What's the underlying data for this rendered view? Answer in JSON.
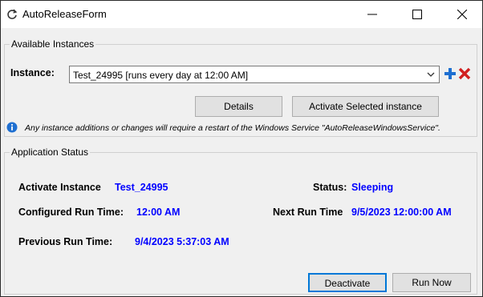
{
  "window": {
    "title": "AutoReleaseForm",
    "icon": "refresh-icon"
  },
  "instances_group": {
    "label": "Available Instances",
    "instance_label": "Instance:",
    "instance_value": "Test_24995 [runs every day at 12:00 AM]",
    "details_label": "Details",
    "activate_label": "Activate Selected instance",
    "info_text": "Any instance additions or changes will require a restart of the Windows Service \"AutoReleaseWindowsService\"."
  },
  "status_group": {
    "label": "Application Status",
    "activate_instance_label": "Activate Instance",
    "activate_instance_value": "Test_24995",
    "status_label": "Status:",
    "status_value": "Sleeping",
    "configured_run_label": "Configured Run Time:",
    "configured_run_value": "12:00 AM",
    "next_run_label": "Next Run Time",
    "next_run_value": "9/5/2023 12:00:00 AM",
    "previous_run_label": "Previous Run Time:",
    "previous_run_value": "9/4/2023 5:37:03 AM",
    "deactivate_label": "Deactivate",
    "run_now_label": "Run Now"
  },
  "colors": {
    "value_text": "#0000ff",
    "add_icon": "#1e6fd1",
    "delete_icon": "#d11f1f",
    "info_icon": "#1e6fd1"
  }
}
